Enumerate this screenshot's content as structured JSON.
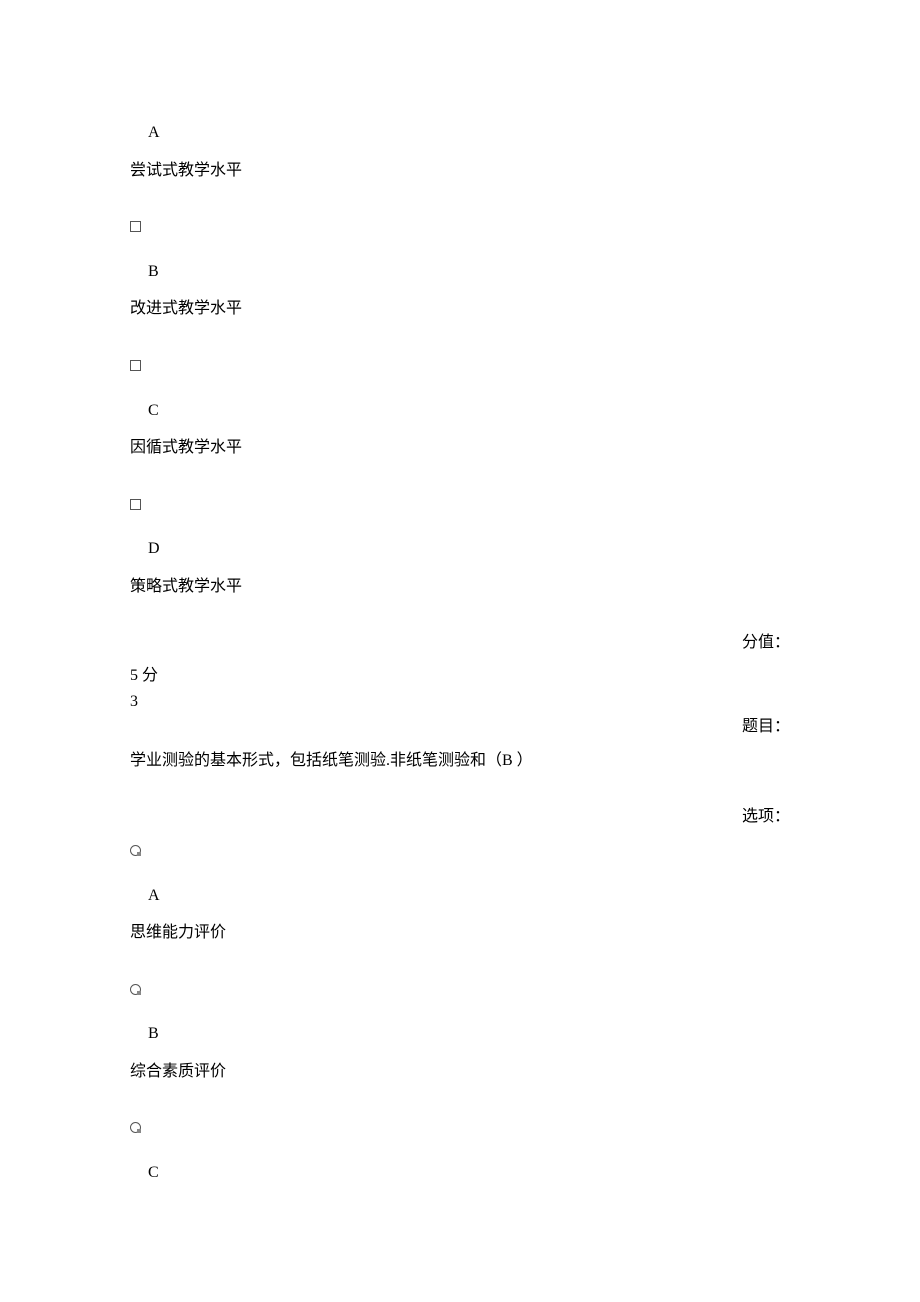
{
  "q2": {
    "options": {
      "a": {
        "letter": "A",
        "text": "尝试式教学水平"
      },
      "b": {
        "letter": "B",
        "text": "改进式教学水平"
      },
      "c": {
        "letter": "C",
        "text": "因循式教学水平"
      },
      "d": {
        "letter": "D",
        "text": "策略式教学水平"
      }
    },
    "score_label": "分值：",
    "score_value": "5 分"
  },
  "q3": {
    "number": "3",
    "stem_label": "题目：",
    "stem_text": "学业测验的基本形式，包括纸笔测验.非纸笔测验和（B ）",
    "options_label": "选项：",
    "options": {
      "a": {
        "letter": "A",
        "text": "思维能力评价"
      },
      "b": {
        "letter": "B",
        "text": "综合素质评价"
      },
      "c": {
        "letter": "C"
      }
    }
  }
}
